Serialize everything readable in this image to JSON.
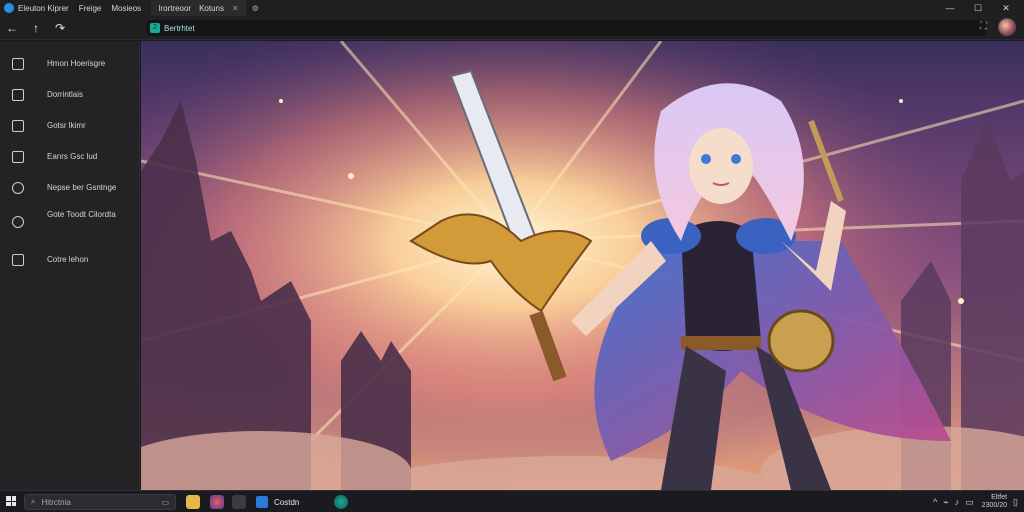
{
  "titlebar": {
    "menu": [
      "Eleuton Kiprer",
      "Freige",
      "Mosieos"
    ],
    "tabs": [
      {
        "label": "Irortreoor",
        "extra": "Kotuns",
        "active": true
      },
      {
        "label": "",
        "active": false
      }
    ],
    "controls": [
      "—",
      "☐",
      "✕"
    ]
  },
  "toolbar": {
    "address_text": "Bertrhtet",
    "back": "←",
    "up": "↑",
    "forward": "↷"
  },
  "sidebar": {
    "items": [
      {
        "label": "Hmon Hoerisgre"
      },
      {
        "label": "Dorrintlais"
      },
      {
        "label": "Gotsr lkimr"
      },
      {
        "label": "Eanrs Gsc lud"
      },
      {
        "label": "Nepse ber Gsntnge"
      },
      {
        "label": "Gote Toodt Cilordta"
      },
      {
        "label": "Cotre lehon"
      }
    ]
  },
  "taskbar": {
    "search_placeholder": "Hitrctnia",
    "app_label": "Costdn",
    "clock_top": "Eltfet",
    "clock_bottom": "2300/20"
  },
  "colors": {
    "accent": "#1ea796",
    "sidebar_bg": "#232325",
    "titlebar_bg": "#1f1f22"
  }
}
